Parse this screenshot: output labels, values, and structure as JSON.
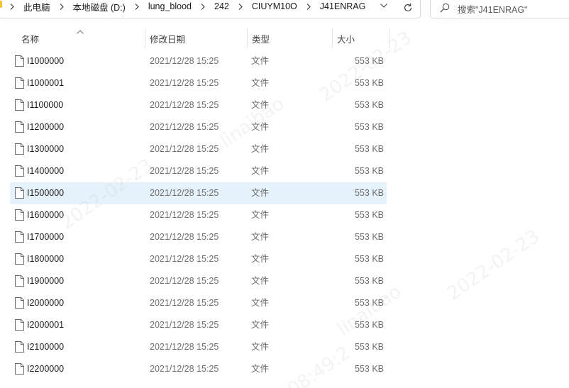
{
  "address_bar": {
    "breadcrumbs": [
      "此电脑",
      "本地磁盘 (D:)",
      "lung_blood",
      "242",
      "CIUYM10O",
      "J41ENRAG"
    ]
  },
  "search": {
    "placeholder": "搜索\"J41ENRAG\""
  },
  "columns": {
    "name": "名称",
    "modified": "修改日期",
    "type": "类型",
    "size": "大小"
  },
  "files": [
    {
      "name": "I1000000",
      "modified": "2021/12/28 15:25",
      "type": "文件",
      "size": "553 KB"
    },
    {
      "name": "I1000001",
      "modified": "2021/12/28 15:25",
      "type": "文件",
      "size": "553 KB"
    },
    {
      "name": "I1100000",
      "modified": "2021/12/28 15:25",
      "type": "文件",
      "size": "553 KB"
    },
    {
      "name": "I1200000",
      "modified": "2021/12/28 15:25",
      "type": "文件",
      "size": "553 KB"
    },
    {
      "name": "I1300000",
      "modified": "2021/12/28 15:25",
      "type": "文件",
      "size": "553 KB"
    },
    {
      "name": "I1400000",
      "modified": "2021/12/28 15:25",
      "type": "文件",
      "size": "553 KB"
    },
    {
      "name": "I1500000",
      "modified": "2021/12/28 15:25",
      "type": "文件",
      "size": "553 KB"
    },
    {
      "name": "I1600000",
      "modified": "2021/12/28 15:25",
      "type": "文件",
      "size": "553 KB"
    },
    {
      "name": "I1700000",
      "modified": "2021/12/28 15:25",
      "type": "文件",
      "size": "553 KB"
    },
    {
      "name": "I1800000",
      "modified": "2021/12/28 15:25",
      "type": "文件",
      "size": "553 KB"
    },
    {
      "name": "I1900000",
      "modified": "2021/12/28 15:25",
      "type": "文件",
      "size": "553 KB"
    },
    {
      "name": "I2000000",
      "modified": "2021/12/28 15:25",
      "type": "文件",
      "size": "553 KB"
    },
    {
      "name": "I2000001",
      "modified": "2021/12/28 15:25",
      "type": "文件",
      "size": "553 KB"
    },
    {
      "name": "I2100000",
      "modified": "2021/12/28 15:25",
      "type": "文件",
      "size": "553 KB"
    },
    {
      "name": "I2200000",
      "modified": "2021/12/28 15:25",
      "type": "文件",
      "size": "553 KB"
    }
  ],
  "watermark": {
    "text_a": "2022-02-23",
    "text_b": "linaibao",
    "text_c": "08:49:2"
  },
  "icons": {
    "chevron": "chevron-right-icon",
    "dropdown": "chevron-down-icon",
    "refresh": "refresh-icon",
    "search": "search-icon",
    "file": "file-icon",
    "sort": "sort-ascending-icon"
  },
  "colors": {
    "selected_row": "#e5f1fb",
    "folder": "#f3c23c"
  }
}
